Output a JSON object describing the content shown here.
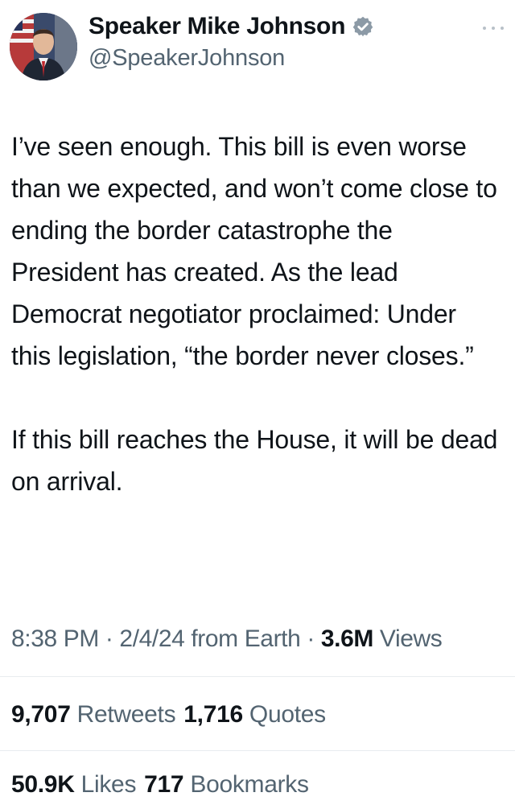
{
  "author": {
    "display_name": "Speaker Mike Johnson",
    "handle": "@SpeakerJohnson",
    "verified_badge_color": "#8c9aa6"
  },
  "tweet": {
    "paragraphs": [
      "I’ve seen enough. This bill is even worse than we expected, and won’t come close to ending the border catastrophe the President has created. As the lead Democrat negotiator proclaimed: Under this legislation, “the border never closes.”",
      "If this bill reaches the House, it will be dead on arrival."
    ]
  },
  "meta": {
    "time": "8:38 PM",
    "separator": " · ",
    "date": "2/4/24",
    "source": " from Earth",
    "views_count": "3.6M",
    "views_label": " Views"
  },
  "stats": {
    "retweets_count": "9,707",
    "retweets_label": "Retweets",
    "quotes_count": "1,716",
    "quotes_label": "Quotes",
    "likes_count": "50.9K",
    "likes_label": "Likes",
    "bookmarks_count": "717",
    "bookmarks_label": "Bookmarks"
  },
  "colors": {
    "text_primary": "#0f1419",
    "text_secondary": "#536471",
    "divider": "#e8ecef"
  }
}
